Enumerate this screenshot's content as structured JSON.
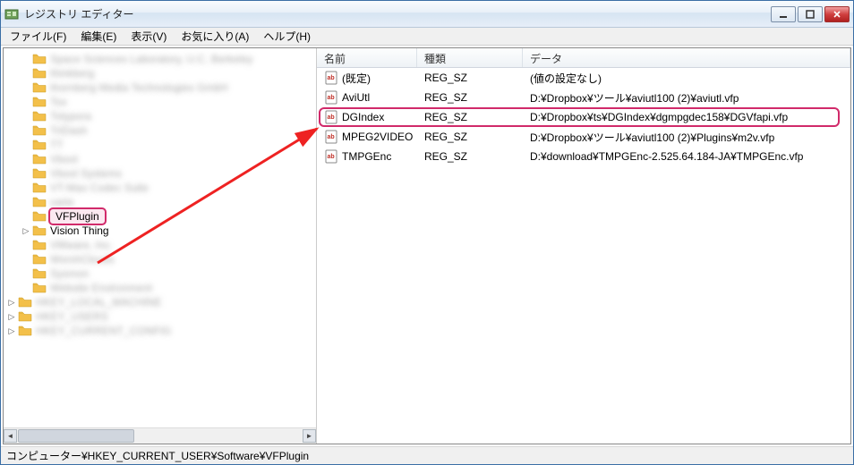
{
  "window": {
    "title": "レジストリ エディター"
  },
  "menu": {
    "file": "ファイル(F)",
    "edit": "編集(E)",
    "view": "表示(V)",
    "favorites": "お気に入り(A)",
    "help": "ヘルプ(H)"
  },
  "tree": {
    "blurred_items_top": [
      "Space Sciences Laboratory, U.C. Berkeley",
      "thinkberg",
      "thornberg Media Technologies GmbH",
      "Tox",
      "Totypora",
      "TriDash",
      "TT",
      "Vbool",
      "Vbool Systems",
      "VT-Max Codec Suite",
      "varte"
    ],
    "selected": "VFPlugin",
    "next_visible": "Vision Thing",
    "blurred_items_bottom": [
      "VMware, Inc.",
      "WorshClouds",
      "Sysmon",
      "Website Environment"
    ],
    "blurred_roots": [
      "HKEY_LOCAL_MACHINE",
      "HKEY_USERS",
      "HKEY_CURRENT_CONFIG"
    ]
  },
  "list": {
    "columns": {
      "name": "名前",
      "type": "種類",
      "data": "データ"
    },
    "rows": [
      {
        "name": "(既定)",
        "type": "REG_SZ",
        "data": "(値の設定なし)",
        "highlighted": false
      },
      {
        "name": "AviUtl",
        "type": "REG_SZ",
        "data": "D:¥Dropbox¥ツール¥aviutl100 (2)¥aviutl.vfp",
        "highlighted": false
      },
      {
        "name": "DGIndex",
        "type": "REG_SZ",
        "data": "D:¥Dropbox¥ts¥DGIndex¥dgmpgdec158¥DGVfapi.vfp",
        "highlighted": true
      },
      {
        "name": "MPEG2VIDEO",
        "type": "REG_SZ",
        "data": "D:¥Dropbox¥ツール¥aviutl100 (2)¥Plugins¥m2v.vfp",
        "highlighted": false
      },
      {
        "name": "TMPGEnc",
        "type": "REG_SZ",
        "data": "D:¥download¥TMPGEnc-2.525.64.184-JA¥TMPGEnc.vfp",
        "highlighted": false
      }
    ]
  },
  "statusbar": {
    "path": "コンピューター¥HKEY_CURRENT_USER¥Software¥VFPlugin"
  },
  "annotation": {
    "arrow_color": "#e22"
  }
}
